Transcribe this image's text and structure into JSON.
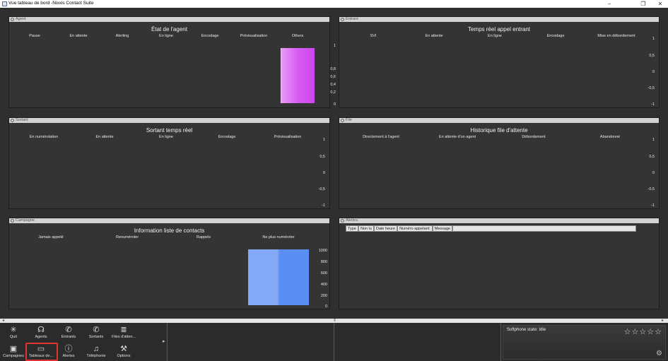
{
  "window": {
    "title": "Vue tableau de bord -Nixxis Contact Suite"
  },
  "panels": {
    "agent": {
      "header": "Agent",
      "title": "État de l'agent",
      "columns": [
        "Pause",
        "En attente",
        "Alerting",
        "En ligne",
        "Encodage",
        "Prévisualisation",
        "Others"
      ],
      "yticks": [
        "1",
        "0,8",
        "0,6",
        "0,4",
        "0,2",
        "0"
      ],
      "chart_data": {
        "type": "bar",
        "categories": [
          "Others"
        ],
        "values": [
          1
        ],
        "ylim": [
          0,
          1
        ],
        "color": "#d458f0"
      }
    },
    "entrant": {
      "header": "Entrant",
      "title": "Temps réel appel entrant",
      "columns": [
        "SVI",
        "En attente",
        "En ligne",
        "Encodage",
        "Mise en débordement"
      ],
      "yticks": [
        "1",
        "0,5",
        "0",
        "-0,5",
        "-1"
      ]
    },
    "sortant": {
      "header": "Sortant",
      "title": "Sortant temps réel",
      "columns": [
        "En numérotation",
        "En attente",
        "En ligne",
        "Encodage",
        "Prévisualisation"
      ],
      "yticks": [
        "1",
        "0,5",
        "0",
        "-0,5",
        "-1"
      ]
    },
    "file": {
      "header": "File",
      "title": "Historique file d'attente",
      "columns": [
        "Directement à l'agent",
        "En attente d'un agent",
        "Débordement",
        "Abandonné"
      ],
      "yticks": [
        "1",
        "0,5",
        "0",
        "-0,5",
        "-1"
      ]
    },
    "campagne": {
      "header": "Campagne",
      "title": "Information liste de contacts",
      "columns": [
        "Jamais appelé",
        "Renuméroter",
        "Rappels",
        "Ne plus numéroter"
      ],
      "yticks": [
        "1000",
        "800",
        "600",
        "400",
        "200",
        "0"
      ],
      "chart_data": {
        "type": "bar",
        "categories": [
          "Ne plus numéroter"
        ],
        "values": [
          1000
        ],
        "ylim": [
          0,
          1000
        ],
        "color": "#5b8ef5"
      }
    },
    "alertes": {
      "header": "Alertes",
      "columns": [
        "Type",
        "Non lu",
        "Date heure",
        "Numéro appelant:",
        "Message"
      ]
    }
  },
  "toolbar": {
    "row1": [
      "Quit",
      "Agents",
      "Entrants",
      "Sortants",
      "Files d'atten..."
    ],
    "row2": [
      "Campagnes",
      "Tableaux de...",
      "Alertes",
      "Téléphonie",
      "Options"
    ]
  },
  "softphone": {
    "state": "Softphone state: Idle"
  }
}
